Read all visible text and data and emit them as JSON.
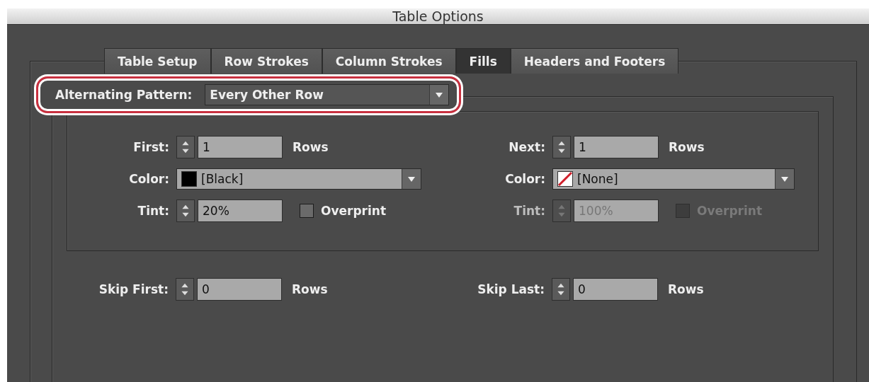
{
  "window": {
    "title": "Table Options"
  },
  "tabs": [
    {
      "label": "Table Setup",
      "selected": false
    },
    {
      "label": "Row Strokes",
      "selected": false
    },
    {
      "label": "Column Strokes",
      "selected": false
    },
    {
      "label": "Fills",
      "selected": true
    },
    {
      "label": "Headers and Footers",
      "selected": false
    }
  ],
  "alternating_pattern": {
    "label": "Alternating Pattern:",
    "value": "Every Other Row",
    "highlighted": true
  },
  "alternating": [
    {
      "count": {
        "label": "First:",
        "value": "1",
        "unit": "Rows"
      },
      "color": {
        "label": "Color:",
        "value": "[Black]",
        "kind": "solid",
        "color": "#000000"
      },
      "tint": {
        "label": "Tint:",
        "value": "20%",
        "disabled": false
      },
      "overprint": {
        "label": "Overprint",
        "checked": false,
        "disabled": false
      }
    },
    {
      "count": {
        "label": "Next:",
        "value": "1",
        "unit": "Rows"
      },
      "color": {
        "label": "Color:",
        "value": "[None]",
        "kind": "none"
      },
      "tint": {
        "label": "Tint:",
        "value": "100%",
        "disabled": true
      },
      "overprint": {
        "label": "Overprint",
        "checked": false,
        "disabled": true
      }
    }
  ],
  "skip": [
    {
      "label": "Skip First:",
      "value": "0",
      "unit": "Rows"
    },
    {
      "label": "Skip Last:",
      "value": "0",
      "unit": "Rows"
    }
  ]
}
